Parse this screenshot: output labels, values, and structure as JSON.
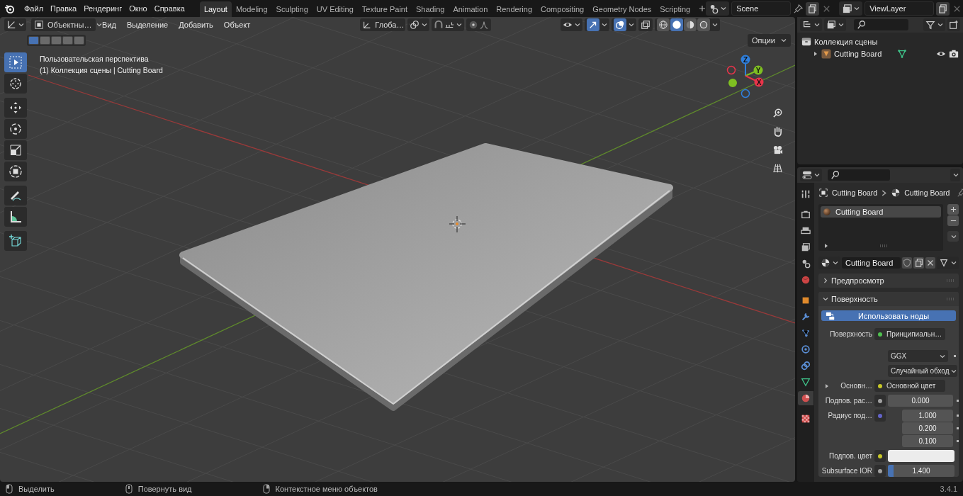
{
  "top_bar": {
    "menus": [
      "Файл",
      "Правка",
      "Рендеринг",
      "Окно",
      "Справка"
    ],
    "workspaces": [
      {
        "label": "Layout",
        "selected": true
      },
      {
        "label": "Modeling",
        "selected": false
      },
      {
        "label": "Sculpting",
        "selected": false
      },
      {
        "label": "UV Editing",
        "selected": false
      },
      {
        "label": "Texture Paint",
        "selected": false
      },
      {
        "label": "Shading",
        "selected": false
      },
      {
        "label": "Animation",
        "selected": false
      },
      {
        "label": "Rendering",
        "selected": false
      },
      {
        "label": "Compositing",
        "selected": false
      },
      {
        "label": "Geometry Nodes",
        "selected": false
      },
      {
        "label": "Scripting",
        "selected": false
      }
    ],
    "scene": "Scene",
    "view_layer": "ViewLayer"
  },
  "viewport": {
    "mode": "Объектны…",
    "menus": [
      "Вид",
      "Выделение",
      "Добавить",
      "Объект"
    ],
    "orientation": "Глоба…",
    "shading": [
      {
        "kind": "wireframe",
        "selected": false
      },
      {
        "kind": "solid",
        "selected": true
      },
      {
        "kind": "material",
        "selected": false
      },
      {
        "kind": "rendered",
        "selected": false
      }
    ],
    "gizmos_on": true,
    "overlays_on": true,
    "options": "Опции",
    "select_modes": [
      {
        "selected": true
      },
      {
        "selected": false
      },
      {
        "selected": false
      },
      {
        "selected": false
      },
      {
        "selected": false
      }
    ],
    "view_name": "Пользовательская перспектива",
    "object_info": "(1) Коллекция сцены | Cutting Board",
    "tools": [
      {
        "kind": "select",
        "selected": true
      },
      {
        "kind": "cursor",
        "selected": false
      },
      {
        "kind": "move",
        "selected": false
      },
      {
        "kind": "rotate",
        "selected": false
      },
      {
        "kind": "scale",
        "selected": false
      },
      {
        "kind": "transform",
        "selected": false
      },
      {
        "kind": "annotate",
        "selected": false
      },
      {
        "kind": "measure",
        "selected": false
      },
      {
        "kind": "add_cube",
        "selected": false
      }
    ],
    "axes": [
      {
        "label": "Z",
        "color": "#2f7fdc"
      },
      {
        "label": "Y",
        "color": "#7fbf22"
      },
      {
        "label": "X",
        "color": "#e8344a"
      }
    ]
  },
  "outliner": {
    "items": [
      {
        "label": "Коллекция сцены",
        "children": [
          {
            "label": "Cutting Board",
            "expanded": false
          }
        ]
      }
    ]
  },
  "properties": {
    "tabs": [
      {
        "kind": "tool",
        "selected": false
      },
      {
        "kind": "render",
        "selected": false
      },
      {
        "kind": "output",
        "selected": false
      },
      {
        "kind": "view_layer",
        "selected": false
      },
      {
        "kind": "scene",
        "selected": false
      },
      {
        "kind": "world",
        "selected": false
      },
      {
        "kind": "object",
        "selected": false
      },
      {
        "kind": "modifiers",
        "selected": false
      },
      {
        "kind": "particles",
        "selected": false
      },
      {
        "kind": "physics",
        "selected": false
      },
      {
        "kind": "constraints",
        "selected": false
      },
      {
        "kind": "data",
        "selected": false
      },
      {
        "kind": "material",
        "selected": true
      },
      {
        "kind": "texture",
        "selected": false
      }
    ],
    "breadcrumb": [
      "Cutting Board",
      "Cutting Board"
    ],
    "slots": [
      {
        "label": "Cutting Board",
        "selected": true
      }
    ],
    "material_name": "Cutting Board",
    "panels": [
      {
        "title": "Предпросмотр",
        "expanded": false
      },
      {
        "title": "Поверхность",
        "expanded": true
      }
    ],
    "use_nodes": "Использовать ноды",
    "rows": [
      {
        "kind": "socket",
        "label": "Поверхность",
        "value": "Принципиальн…",
        "color": "#4fc04f"
      },
      {
        "kind": "dropdown",
        "value": "GGX"
      },
      {
        "kind": "dropdown",
        "value": "Случайный обход"
      },
      {
        "kind": "socket",
        "label": "Основн…",
        "value": "Основной цвет",
        "color": "#c7c729",
        "expandable": true
      },
      {
        "kind": "number",
        "label": "Подпов. рас…",
        "values": [
          "0.000"
        ],
        "color": "#a1a1a1"
      },
      {
        "kind": "number",
        "label": "Радиус под…",
        "values": [
          "1.000",
          "0.200",
          "0.100"
        ],
        "color": "#6363c7"
      },
      {
        "kind": "swatch",
        "label": "Подпов. цвет",
        "color": "#c7c729"
      },
      {
        "kind": "slider",
        "label": "Subsurface IOR",
        "value": "1.400",
        "level": 0.08,
        "color": "#a1a1a1"
      }
    ]
  },
  "status_bar": {
    "hints": [
      {
        "kind": "left",
        "label": "Выделить"
      },
      {
        "kind": "middle",
        "label": "Повернуть вид"
      },
      {
        "kind": "right",
        "label": "Контекстное меню объектов"
      }
    ],
    "version": "3.4.1"
  }
}
